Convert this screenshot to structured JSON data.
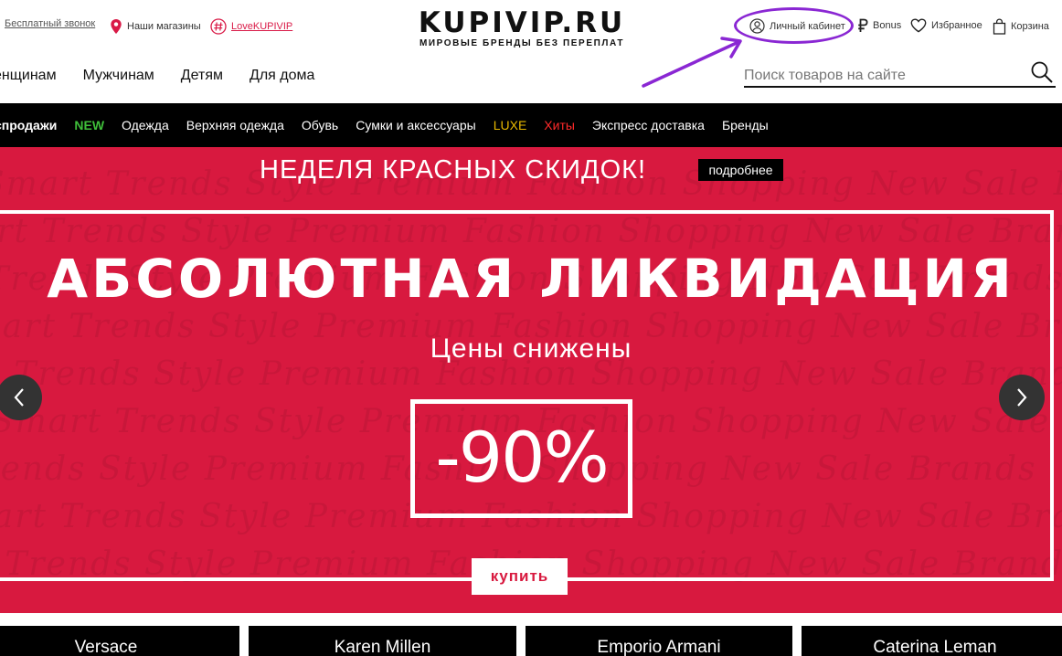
{
  "header": {
    "callback_label": "Бесплатный звонок",
    "stores_label": "Наши магазины",
    "tag_label": "LoveKUPIVIP",
    "logo_text": "KUPIVIP.RU",
    "logo_tagline": "МИРОВЫЕ БРЕНДЫ БЕЗ ПЕРЕПЛАТ",
    "cabinet_label": "Личный кабинет",
    "bonus_label": "Bonus",
    "favorites_label": "Избранное",
    "cart_label": "Корзина"
  },
  "main_nav": [
    {
      "label": "енщинам"
    },
    {
      "label": "Мужчинам"
    },
    {
      "label": "Детям"
    },
    {
      "label": "Для дома"
    }
  ],
  "search": {
    "placeholder": "Поиск товаров на сайте"
  },
  "category_bar": [
    {
      "label": "спродажи"
    },
    {
      "label": "NEW"
    },
    {
      "label": "Одежда"
    },
    {
      "label": "Верхняя одежда"
    },
    {
      "label": "Обувь"
    },
    {
      "label": "Сумки и аксессуары"
    },
    {
      "label": "LUXE"
    },
    {
      "label": "Хиты"
    },
    {
      "label": "Экспресс доставка"
    },
    {
      "label": "Бренды"
    }
  ],
  "banner": {
    "week_text": "НЕДЕЛЯ КРАСНЫХ СКИДОК!",
    "more_label": "подробнее",
    "headline": "АБСОЛЮТНАЯ ЛИКВИДАЦИЯ",
    "subheadline": "Цены снижены",
    "discount": "-90%",
    "buy_label": "купить",
    "background_color": "#d8193f",
    "background_script_words": "Smart Trends Style Premium Fashion Shopping New Sale Brands"
  },
  "brand_tiles": [
    {
      "label": "Versace"
    },
    {
      "label": "Karen Millen"
    },
    {
      "label": "Emporio Armani"
    },
    {
      "label": "Caterina Leman"
    }
  ],
  "colors": {
    "accent_red": "#d8193f",
    "annotation_purple": "#8a27d3",
    "new_green": "#3fbf3a",
    "luxe_gold": "#e8b800",
    "hits_red": "#ff2a2a"
  }
}
